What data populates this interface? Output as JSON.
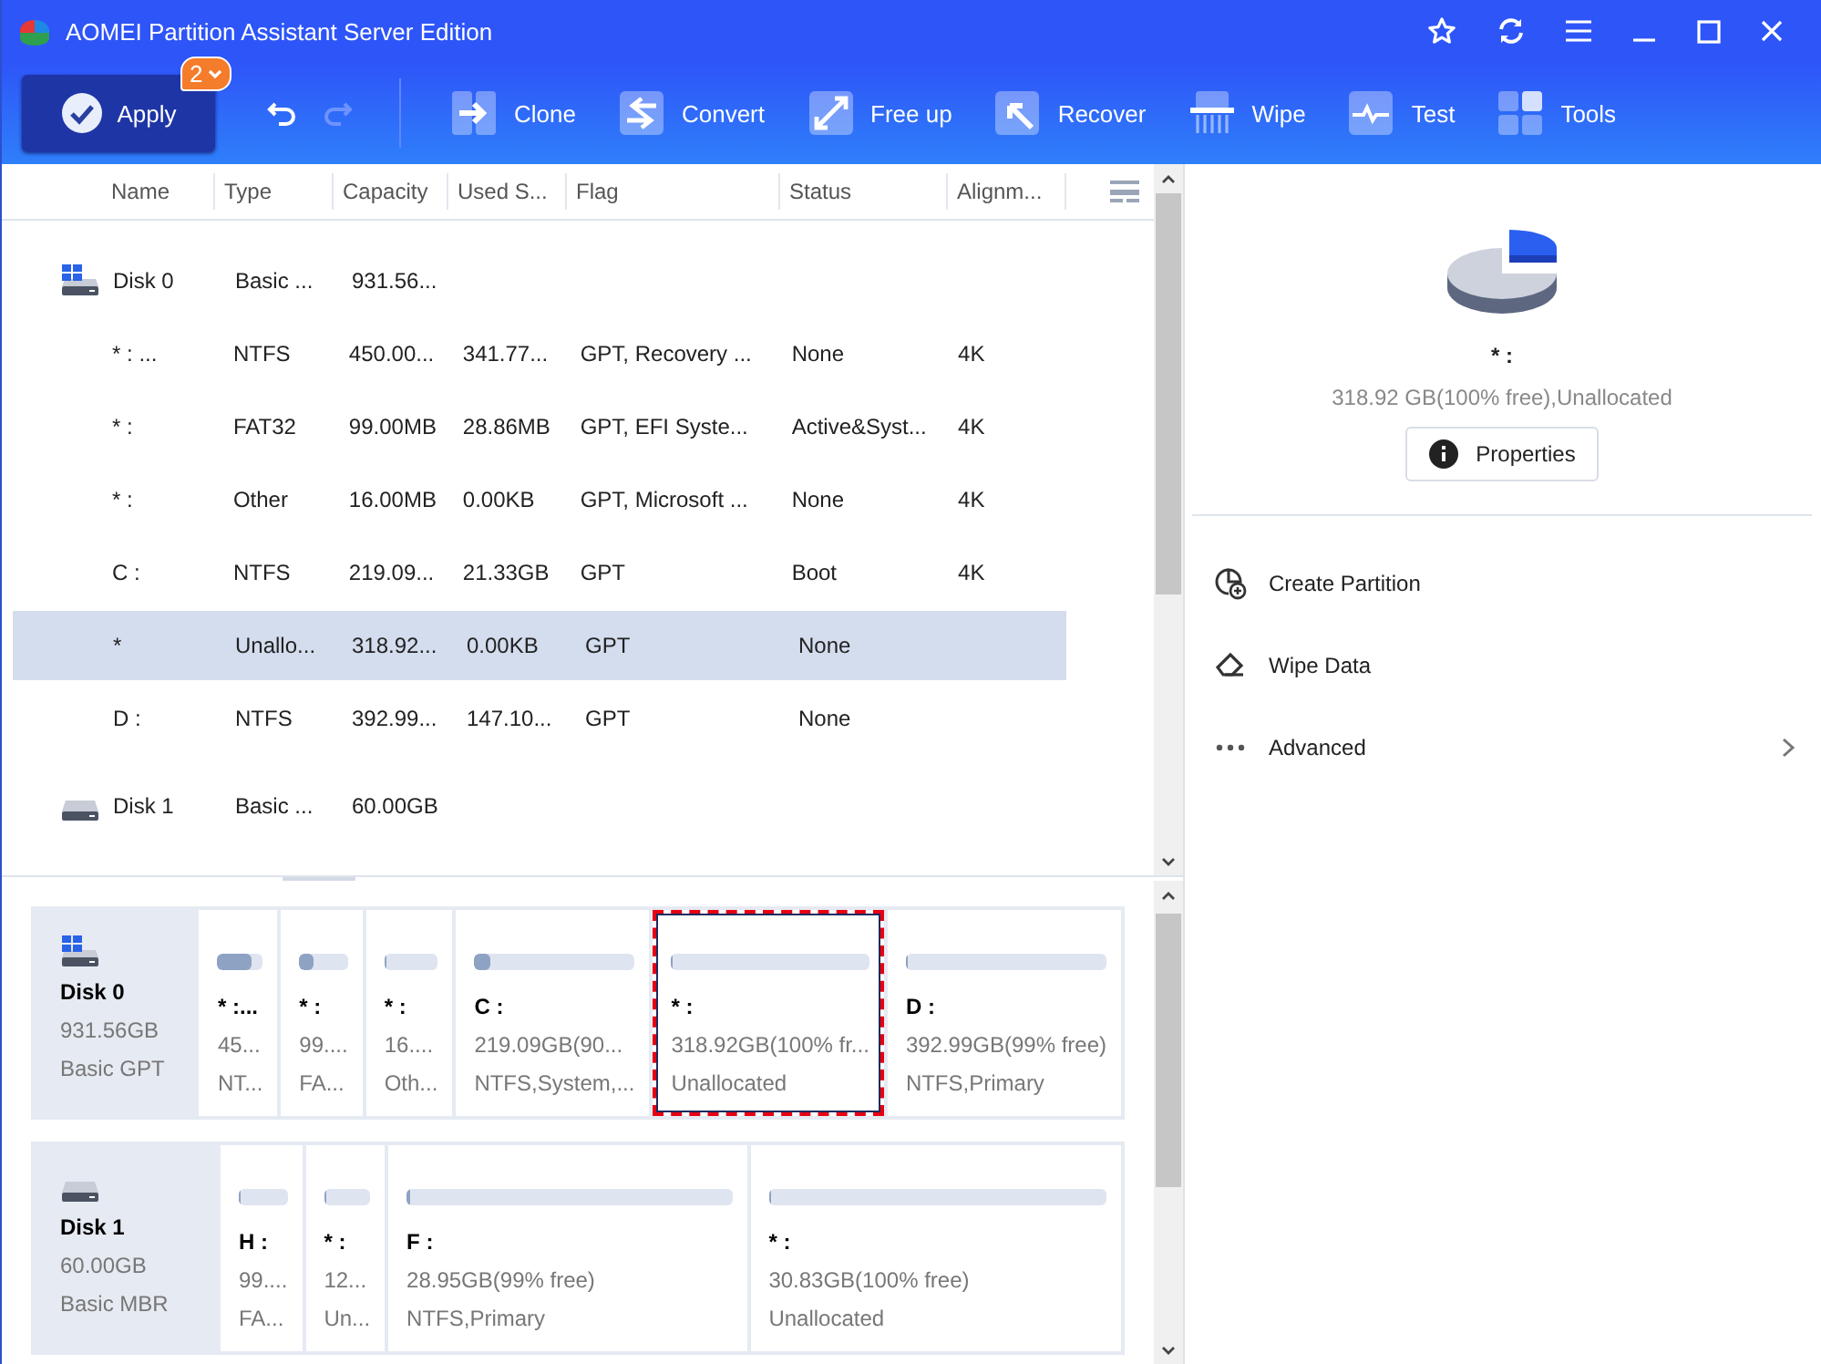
{
  "window": {
    "title": "AOMEI Partition Assistant Server Edition"
  },
  "toolbar": {
    "apply": {
      "label": "Apply",
      "badge": "2"
    },
    "undo": {
      "disabled": false
    },
    "redo": {
      "disabled": true
    },
    "tools": [
      {
        "kind": "clone",
        "label": "Clone"
      },
      {
        "kind": "convert",
        "label": "Convert"
      },
      {
        "kind": "free-up",
        "label": "Free up"
      },
      {
        "kind": "recover",
        "label": "Recover"
      },
      {
        "kind": "wipe",
        "label": "Wipe"
      },
      {
        "kind": "test",
        "label": "Test"
      },
      {
        "kind": "tools",
        "label": "Tools"
      }
    ]
  },
  "table": {
    "columns": [
      "Name",
      "Type",
      "Capacity",
      "Used S...",
      "Flag",
      "Status",
      "Alignm..."
    ],
    "rows": [
      {
        "kind": "system-disk",
        "selected": false,
        "cells": [
          "Disk 0",
          "Basic ...",
          "931.56..."
        ]
      },
      {
        "kind": "partition",
        "selected": false,
        "cells": [
          "* : ...",
          "NTFS",
          "450.00...",
          "341.77...",
          "GPT, Recovery ...",
          "None",
          "4K"
        ]
      },
      {
        "kind": "partition",
        "selected": false,
        "cells": [
          "* :",
          "FAT32",
          "99.00MB",
          "28.86MB",
          "GPT, EFI Syste...",
          "Active&Syst...",
          "4K"
        ]
      },
      {
        "kind": "partition",
        "selected": false,
        "cells": [
          "* :",
          "Other",
          "16.00MB",
          "0.00KB",
          "GPT, Microsoft ...",
          "None",
          "4K"
        ]
      },
      {
        "kind": "partition",
        "selected": false,
        "cells": [
          "C :",
          "NTFS",
          "219.09...",
          "21.33GB",
          "GPT",
          "Boot",
          "4K"
        ]
      },
      {
        "kind": "partition",
        "selected": true,
        "cells": [
          "*",
          "Unallo...",
          "318.92...",
          "0.00KB",
          "GPT",
          "None"
        ]
      },
      {
        "kind": "partition",
        "selected": false,
        "cells": [
          "D :",
          "NTFS",
          "392.99...",
          "147.10...",
          "GPT",
          "None"
        ]
      },
      {
        "kind": "disk",
        "selected": false,
        "cells": [
          "Disk 1",
          "Basic ...",
          "60.00GB"
        ]
      }
    ]
  },
  "disk_map": [
    {
      "kind": "system-disk",
      "name": "Disk 0",
      "size": "931.56GB",
      "style": "Basic GPT",
      "partitions": [
        {
          "name": "* :...",
          "info": "45...",
          "type": "NT...",
          "level": 0.76,
          "selected": false
        },
        {
          "name": "* :",
          "info": "99....",
          "type": "FA...",
          "level": 0.29,
          "selected": false
        },
        {
          "name": "* :",
          "info": "16....",
          "type": "Oth...",
          "level": 0,
          "selected": false
        },
        {
          "name": "C :",
          "info": "219.09GB(90...",
          "type": "NTFS,System,...",
          "level": 0.1,
          "selected": false
        },
        {
          "name": "* :",
          "info": "318.92GB(100% fr...",
          "type": "Unallocated",
          "level": 0,
          "selected": true
        },
        {
          "name": "D :",
          "info": "392.99GB(99% free)",
          "type": "NTFS,Primary",
          "level": 0.01,
          "selected": false
        }
      ]
    },
    {
      "kind": "disk",
      "name": "Disk 1",
      "size": "60.00GB",
      "style": "Basic MBR",
      "partitions": [
        {
          "name": "H :",
          "info": "99....",
          "type": "FA...",
          "level": 0,
          "selected": false
        },
        {
          "name": "* :",
          "info": "12...",
          "type": "Un...",
          "level": 0,
          "selected": false
        },
        {
          "name": "F :",
          "info": "28.95GB(99% free)",
          "type": "NTFS,Primary",
          "level": 0.01,
          "selected": false
        },
        {
          "name": "* :",
          "info": "30.83GB(100% free)",
          "type": "Unallocated",
          "level": 0,
          "selected": false
        }
      ]
    }
  ],
  "details": {
    "name": "* :",
    "info": "318.92 GB(100% free),Unallocated",
    "properties_button": "Properties",
    "actions": [
      {
        "kind": "create",
        "label": "Create Partition",
        "has_submenu": false
      },
      {
        "kind": "wipe",
        "label": "Wipe Data",
        "has_submenu": false
      },
      {
        "kind": "more",
        "label": "Advanced",
        "has_submenu": true
      }
    ]
  }
}
